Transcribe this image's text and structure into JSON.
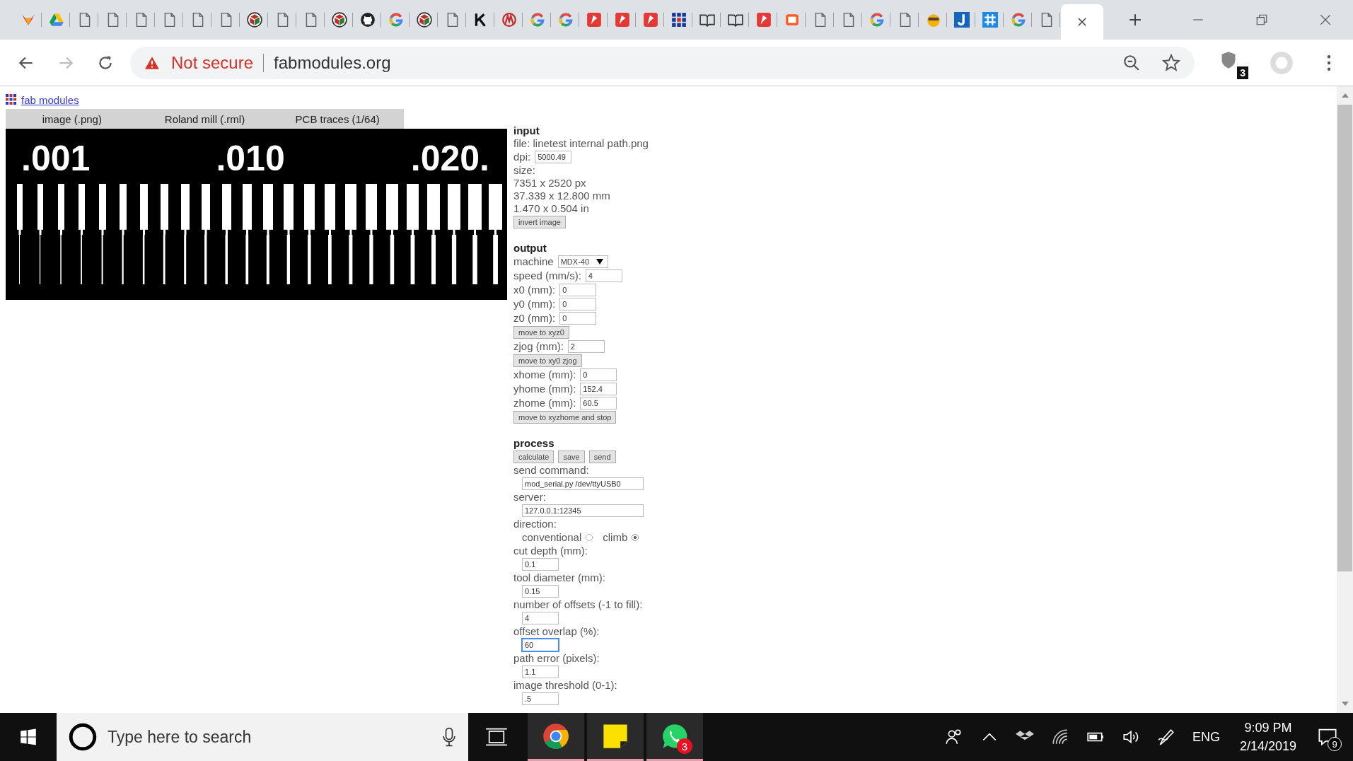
{
  "browser": {
    "tabs": [
      {
        "kind": "fox",
        "selected": false
      },
      {
        "kind": "drive",
        "selected": false
      },
      {
        "kind": "page",
        "selected": false
      },
      {
        "kind": "page",
        "selected": false
      },
      {
        "kind": "page",
        "selected": false
      },
      {
        "kind": "page",
        "selected": false
      },
      {
        "kind": "page",
        "selected": false
      },
      {
        "kind": "page",
        "selected": false
      },
      {
        "kind": "cube",
        "selected": false
      },
      {
        "kind": "page",
        "selected": false
      },
      {
        "kind": "page",
        "selected": false
      },
      {
        "kind": "cube",
        "selected": false
      },
      {
        "kind": "github",
        "selected": false
      },
      {
        "kind": "g",
        "selected": false
      },
      {
        "kind": "cube",
        "selected": false
      },
      {
        "kind": "page",
        "selected": false
      },
      {
        "kind": "k",
        "selected": false
      },
      {
        "kind": "fish",
        "selected": false
      },
      {
        "kind": "g",
        "selected": false
      },
      {
        "kind": "g",
        "selected": false
      },
      {
        "kind": "red",
        "selected": false
      },
      {
        "kind": "red",
        "selected": false
      },
      {
        "kind": "red",
        "selected": false
      },
      {
        "kind": "grid",
        "selected": false
      },
      {
        "kind": "book",
        "selected": false
      },
      {
        "kind": "book",
        "selected": false
      },
      {
        "kind": "red",
        "selected": false
      },
      {
        "kind": "chip",
        "selected": false
      },
      {
        "kind": "page",
        "selected": false
      },
      {
        "kind": "page",
        "selected": false
      },
      {
        "kind": "g",
        "selected": false
      },
      {
        "kind": "page",
        "selected": false
      },
      {
        "kind": "face",
        "selected": false
      },
      {
        "kind": "j",
        "selected": false
      },
      {
        "kind": "hash",
        "selected": false
      },
      {
        "kind": "g",
        "selected": false
      },
      {
        "kind": "page",
        "selected": false
      },
      {
        "kind": "none",
        "selected": true
      }
    ],
    "forward_disabled": true,
    "security": "Not secure",
    "url": "fabmodules.org",
    "extension_badge": "3"
  },
  "page": {
    "home_link": "fab modules",
    "steps": [
      "image (.png)",
      "Roland mill (.rml)",
      "PCB traces (1/64)"
    ],
    "preview_labels": [
      ".001",
      ".010",
      ".020."
    ],
    "sections": [
      {
        "title": "input",
        "rows": [
          {
            "kind": "text",
            "text": "file: linetest internal path.png"
          },
          {
            "kind": "field",
            "label": "dpi:",
            "value": "5000.49"
          },
          {
            "kind": "text",
            "text": "size:"
          },
          {
            "kind": "text",
            "text": "7351 x 2520 px"
          },
          {
            "kind": "text",
            "text": "37.339 x 12.800 mm"
          },
          {
            "kind": "text",
            "text": "1.470 x 0.504 in"
          },
          {
            "kind": "buttons",
            "buttons": [
              "invert image"
            ]
          }
        ]
      },
      {
        "title": "output",
        "rows": [
          {
            "kind": "select",
            "label": "machine",
            "value": "MDX-40"
          },
          {
            "kind": "field",
            "label": "speed (mm/s):",
            "value": "4"
          },
          {
            "kind": "field",
            "label": "x0 (mm):",
            "value": "0"
          },
          {
            "kind": "field",
            "label": "y0 (mm):",
            "value": "0"
          },
          {
            "kind": "field",
            "label": "z0 (mm):",
            "value": "0"
          },
          {
            "kind": "buttons",
            "buttons": [
              "move to xyz0"
            ]
          },
          {
            "kind": "field",
            "label": "zjog (mm):",
            "value": "2"
          },
          {
            "kind": "buttons",
            "buttons": [
              "move to xy0 zjog"
            ]
          },
          {
            "kind": "field",
            "label": "xhome (mm):",
            "value": "0"
          },
          {
            "kind": "field",
            "label": "yhome (mm):",
            "value": "152.4"
          },
          {
            "kind": "field",
            "label": "zhome (mm):",
            "value": "60.5"
          },
          {
            "kind": "buttons",
            "buttons": [
              "move to xyzhome and stop"
            ]
          }
        ]
      },
      {
        "title": "process",
        "rows": [
          {
            "kind": "buttons",
            "buttons": [
              "calculate",
              "save",
              "send"
            ]
          },
          {
            "kind": "text",
            "text": "send command:"
          },
          {
            "kind": "subfield",
            "value": "mod_serial.py /dev/ttyUSB0",
            "wide": true,
            "focused": false
          },
          {
            "kind": "text",
            "text": "server:"
          },
          {
            "kind": "subfield",
            "value": "127.0.0.1:12345",
            "wide": true,
            "focused": false
          },
          {
            "kind": "text",
            "text": "direction:"
          },
          {
            "kind": "radio",
            "options": [
              {
                "label": "conventional",
                "selected": false
              },
              {
                "label": "climb",
                "selected": true
              }
            ]
          },
          {
            "kind": "text",
            "text": "cut depth (mm):"
          },
          {
            "kind": "subfield",
            "value": "0.1",
            "wide": false,
            "focused": false
          },
          {
            "kind": "text",
            "text": "tool diameter (mm):"
          },
          {
            "kind": "subfield",
            "value": "0.15",
            "wide": false,
            "focused": false
          },
          {
            "kind": "text",
            "text": "number of offsets (-1 to fill):"
          },
          {
            "kind": "subfield",
            "value": "4",
            "wide": false,
            "focused": false
          },
          {
            "kind": "text",
            "text": "offset overlap (%):"
          },
          {
            "kind": "subfield",
            "value": "60",
            "wide": false,
            "focused": true
          },
          {
            "kind": "text",
            "text": "path error (pixels):"
          },
          {
            "kind": "subfield",
            "value": "1.1",
            "wide": false,
            "focused": false
          },
          {
            "kind": "text",
            "text": "image threshold (0-1):"
          },
          {
            "kind": "subfield",
            "value": ".5",
            "wide": false,
            "focused": false
          }
        ]
      }
    ]
  },
  "taskbar": {
    "search_placeholder": "Type here to search",
    "apps": [
      {
        "kind": "chrome",
        "open": true
      },
      {
        "kind": "notes",
        "open": true
      },
      {
        "kind": "whatsapp",
        "open": true,
        "badge": "3"
      }
    ],
    "language": "ENG",
    "time": "9:09 PM",
    "date": "2/14/2019",
    "notifications": "9"
  }
}
